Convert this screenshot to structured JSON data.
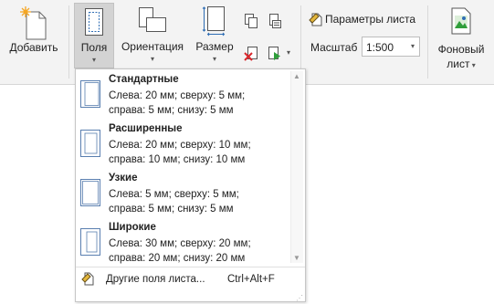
{
  "ribbon": {
    "add_label": "Добавить",
    "margins_label": "Поля",
    "orientation_label": "Ориентация",
    "size_label": "Размер",
    "sheet_params_label": "Параметры листа",
    "scale_label": "Масштаб",
    "scale_value": "1:500",
    "background_label_1": "Фоновый",
    "background_label_2": "лист"
  },
  "margins_menu": {
    "items": [
      {
        "title": "Стандартные",
        "line1": "Слева: 20 мм; сверху: 5 мм;",
        "line2": "справа: 5 мм; снизу: 5 мм"
      },
      {
        "title": "Расширенные",
        "line1": "Слева: 20 мм; сверху: 10 мм;",
        "line2": "справа: 10 мм; снизу: 10 мм"
      },
      {
        "title": "Узкие",
        "line1": "Слева: 5 мм; сверху: 5 мм;",
        "line2": "справа: 5 мм; снизу: 5 мм"
      },
      {
        "title": "Широкие",
        "line1": "Слева: 30 мм; сверху: 20 мм;",
        "line2": "справа: 20 мм; снизу: 20 мм"
      }
    ],
    "other_label": "Другие поля листа...",
    "other_shortcut": "Ctrl+Alt+F"
  },
  "icons": {
    "add": "new-sheet-icon",
    "margins": "margins-icon",
    "orientation": "orientation-icon",
    "size": "page-size-icon",
    "copy": "copy-icon",
    "copy_format": "copy-format-icon",
    "delete": "delete-sheet-icon",
    "play": "play-icon",
    "sheet_params": "sheet-params-icon",
    "background": "background-sheet-icon"
  },
  "colors": {
    "accent_blue": "#2e6db4",
    "delete_red": "#d9262b",
    "play_green": "#2f9e3a",
    "star_orange": "#f5a623"
  }
}
